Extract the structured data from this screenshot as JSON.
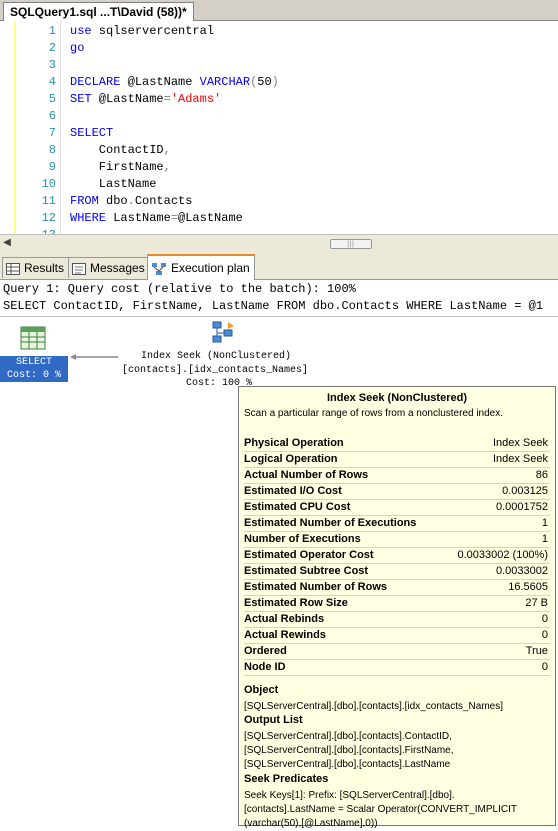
{
  "doc_tab": {
    "title": "SQLQuery1.sql ...T\\David (58))*"
  },
  "editor": {
    "lines": [
      {
        "n": "1",
        "tokens": [
          {
            "t": "use",
            "k": "kw"
          },
          {
            "t": " sqlservercentral",
            "k": "plain"
          }
        ]
      },
      {
        "n": "2",
        "tokens": [
          {
            "t": "go",
            "k": "kw"
          }
        ]
      },
      {
        "n": "3",
        "tokens": []
      },
      {
        "n": "4",
        "tokens": [
          {
            "t": "DECLARE",
            "k": "kw"
          },
          {
            "t": " @LastName ",
            "k": "plain"
          },
          {
            "t": "VARCHAR",
            "k": "kw"
          },
          {
            "t": "(",
            "k": "gray"
          },
          {
            "t": "50",
            "k": "plain"
          },
          {
            "t": ")",
            "k": "gray"
          }
        ]
      },
      {
        "n": "5",
        "tokens": [
          {
            "t": "SET",
            "k": "kw"
          },
          {
            "t": " @LastName",
            "k": "plain"
          },
          {
            "t": "=",
            "k": "gray"
          },
          {
            "t": "'Adams'",
            "k": "str"
          }
        ]
      },
      {
        "n": "6",
        "tokens": []
      },
      {
        "n": "7",
        "tokens": [
          {
            "t": "SELECT",
            "k": "kw"
          }
        ]
      },
      {
        "n": "8",
        "tokens": [
          {
            "t": "    ContactID",
            "k": "plain"
          },
          {
            "t": ",",
            "k": "gray"
          }
        ]
      },
      {
        "n": "9",
        "tokens": [
          {
            "t": "    FirstName",
            "k": "plain"
          },
          {
            "t": ",",
            "k": "gray"
          }
        ]
      },
      {
        "n": "10",
        "tokens": [
          {
            "t": "    LastName",
            "k": "plain"
          }
        ]
      },
      {
        "n": "11",
        "tokens": [
          {
            "t": "FROM",
            "k": "kw"
          },
          {
            "t": " dbo",
            "k": "plain"
          },
          {
            "t": ".",
            "k": "gray"
          },
          {
            "t": "Contacts",
            "k": "plain"
          }
        ]
      },
      {
        "n": "12",
        "tokens": [
          {
            "t": "WHERE",
            "k": "kw"
          },
          {
            "t": " LastName",
            "k": "plain"
          },
          {
            "t": "=",
            "k": "gray"
          },
          {
            "t": "@LastName",
            "k": "plain"
          }
        ]
      },
      {
        "n": "13",
        "tokens": []
      }
    ]
  },
  "result_tabs": [
    {
      "label": "Results",
      "icon": "grid-icon",
      "active": false
    },
    {
      "label": "Messages",
      "icon": "messages-icon",
      "active": false
    },
    {
      "label": "Execution plan",
      "icon": "execution-plan-icon",
      "active": true
    }
  ],
  "plan": {
    "query_header": "Query 1: Query cost (relative to the batch): 100%",
    "query_sql": "SELECT ContactID, FirstName, LastName FROM dbo.Contacts WHERE LastName = @1",
    "select_node": {
      "label": "SELECT",
      "cost": "Cost: 0 %"
    },
    "seek_node": {
      "label": "Index Seek (NonClustered)",
      "object": "[contacts].[idx_contacts_Names]",
      "cost": "Cost: 100 %"
    }
  },
  "tooltip": {
    "title": "Index Seek (NonClustered)",
    "description": "Scan a particular range of rows from a nonclustered index.",
    "properties": [
      {
        "k": "Physical Operation",
        "v": "Index Seek"
      },
      {
        "k": "Logical Operation",
        "v": "Index Seek"
      },
      {
        "k": "Actual Number of Rows",
        "v": "86"
      },
      {
        "k": "Estimated I/O Cost",
        "v": "0.003125"
      },
      {
        "k": "Estimated CPU Cost",
        "v": "0.0001752"
      },
      {
        "k": "Estimated Number of Executions",
        "v": "1"
      },
      {
        "k": "Number of Executions",
        "v": "1"
      },
      {
        "k": "Estimated Operator Cost",
        "v": "0.0033002 (100%)"
      },
      {
        "k": "Estimated Subtree Cost",
        "v": "0.0033002"
      },
      {
        "k": "Estimated Number of Rows",
        "v": "16.5605"
      },
      {
        "k": "Estimated Row Size",
        "v": "27 B"
      },
      {
        "k": "Actual Rebinds",
        "v": "0"
      },
      {
        "k": "Actual Rewinds",
        "v": "0"
      },
      {
        "k": "Ordered",
        "v": "True"
      },
      {
        "k": "Node ID",
        "v": "0"
      }
    ],
    "object_label": "Object",
    "object_value": "[SQLServerCentral].[dbo].[contacts].[idx_contacts_Names]",
    "output_label": "Output List",
    "output_values": [
      "[SQLServerCentral].[dbo].[contacts].ContactID,",
      "[SQLServerCentral].[dbo].[contacts].FirstName,",
      "[SQLServerCentral].[dbo].[contacts].LastName"
    ],
    "seek_label": "Seek Predicates",
    "seek_values": [
      "Seek Keys[1]: Prefix: [SQLServerCentral].[dbo].",
      "[contacts].LastName = Scalar Operator(CONVERT_IMPLICIT",
      "(varchar(50),[@LastName],0))"
    ]
  },
  "colors": {
    "keyword": "#0000ff",
    "string": "#ff0000",
    "line_number": "#2b91af",
    "selection": "#316ac5",
    "tooltip_bg": "#ffffe1"
  }
}
